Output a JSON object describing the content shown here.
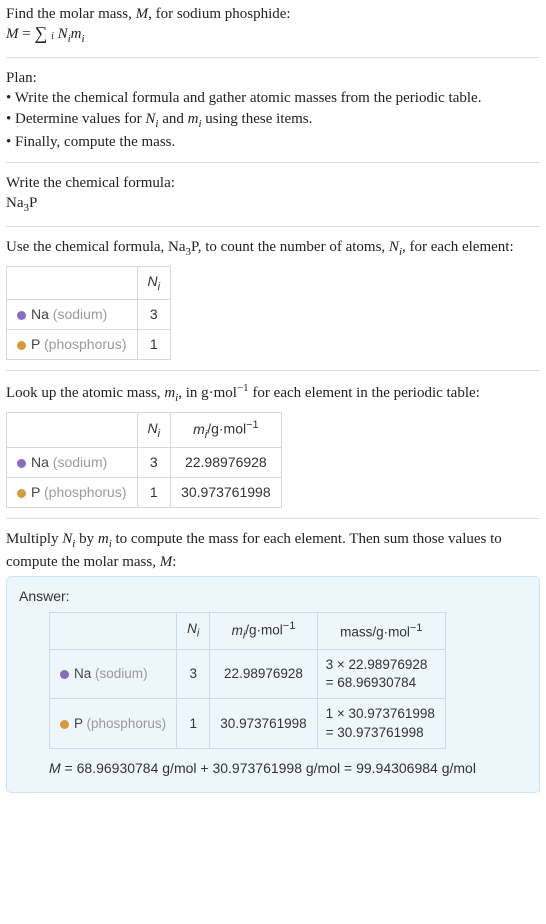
{
  "intro": {
    "line1": "Find the molar mass, ",
    "line1_var": "M",
    "line1_after": ", for sodium phosphide:",
    "equation_lhs": "M = ",
    "equation_sum_sub": "i",
    "equation_rhs_html": "Nᵢmᵢ"
  },
  "plan": {
    "heading": "Plan:",
    "b1": "• Write the chemical formula and gather atomic masses from the periodic table.",
    "b2_a": "• Determine values for ",
    "b2_b": " and ",
    "b2_c": " using these items.",
    "b3": "• Finally, compute the mass."
  },
  "step_formula": {
    "line": "Write the chemical formula:",
    "formula_html": "Na₃P"
  },
  "step_count": {
    "line_a": "Use the chemical formula, Na",
    "line_sub": "3",
    "line_b": "P, to count the number of atoms, ",
    "line_c": ", for each element:"
  },
  "table1": {
    "h2": "Nᵢ",
    "rows": [
      {
        "sym": "Na",
        "name": "sodium",
        "n": "3",
        "dot": "dot-na"
      },
      {
        "sym": "P",
        "name": "phosphorus",
        "n": "1",
        "dot": "dot-p"
      }
    ]
  },
  "step_lookup": {
    "line_a": "Look up the atomic mass, ",
    "line_b": ", in g·mol",
    "line_sup": "−1",
    "line_c": " for each element in the periodic table:"
  },
  "table2": {
    "h2": "Nᵢ",
    "h3_a": "mᵢ/g·mol",
    "h3_sup": "−1",
    "rows": [
      {
        "sym": "Na",
        "name": "sodium",
        "n": "3",
        "m": "22.98976928",
        "dot": "dot-na"
      },
      {
        "sym": "P",
        "name": "phosphorus",
        "n": "1",
        "m": "30.973761998",
        "dot": "dot-p"
      }
    ]
  },
  "step_multiply": {
    "line_a": "Multiply ",
    "line_b": " by ",
    "line_c": " to compute the mass for each element. Then sum those values to compute the molar mass, ",
    "line_d": ":"
  },
  "answer": {
    "label": "Answer:",
    "h2": "Nᵢ",
    "h3_a": "mᵢ/g·mol",
    "h3_sup": "−1",
    "h4_a": "mass/g·mol",
    "h4_sup": "−1",
    "rows": [
      {
        "sym": "Na",
        "name": "sodium",
        "n": "3",
        "m": "22.98976928",
        "calc1": "3 × 22.98976928",
        "calc2": "= 68.96930784",
        "dot": "dot-na"
      },
      {
        "sym": "P",
        "name": "phosphorus",
        "n": "1",
        "m": "30.973761998",
        "calc1": "1 × 30.973761998",
        "calc2": "= 30.973761998",
        "dot": "dot-p"
      }
    ],
    "final_a": "M",
    "final_b": " = 68.96930784 g/mol + 30.973761998 g/mol = 99.94306984 g/mol"
  }
}
